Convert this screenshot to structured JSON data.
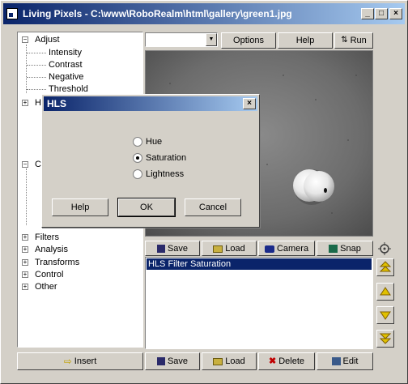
{
  "window": {
    "title": "Living Pixels - C:\\www\\RoboRealm\\html\\gallery\\green1.jpg"
  },
  "tree": {
    "items": [
      {
        "label": "Adjust",
        "expander": "−"
      },
      {
        "label": "Intensity"
      },
      {
        "label": "Contrast"
      },
      {
        "label": "Negative"
      },
      {
        "label": "Threshold"
      },
      {
        "label": "H",
        "expander": "+"
      },
      {
        "label": "C",
        "expander": "−"
      },
      {
        "label": "Filters",
        "expander": "+"
      },
      {
        "label": "Analysis",
        "expander": "+"
      },
      {
        "label": "Transforms",
        "expander": "+"
      },
      {
        "label": "Control",
        "expander": "+"
      },
      {
        "label": "Other",
        "expander": "+"
      }
    ]
  },
  "toolbar": {
    "combo_value": "",
    "options_label": "Options",
    "help_label": "Help",
    "run_label": "Run"
  },
  "imageview": {
    "name": "processed image preview"
  },
  "pipeline_toolbar": {
    "save_label": "Save",
    "load_label": "Load",
    "camera_label": "Camera",
    "snap_label": "Snap"
  },
  "pipeline_list": {
    "items": [
      "HLS Filter Saturation"
    ]
  },
  "bottom_bar": {
    "insert_label": "Insert",
    "save_label": "Save",
    "load_label": "Load",
    "delete_label": "Delete",
    "edit_label": "Edit"
  },
  "dialog": {
    "title": "HLS",
    "options": [
      "Hue",
      "Saturation",
      "Lightness"
    ],
    "selected": "Saturation",
    "help_label": "Help",
    "ok_label": "OK",
    "cancel_label": "Cancel"
  },
  "colors": {
    "titlebar_start": "#0a246a",
    "titlebar_end": "#a6caf0",
    "face": "#d4d0c8",
    "selection": "#0a246a"
  }
}
